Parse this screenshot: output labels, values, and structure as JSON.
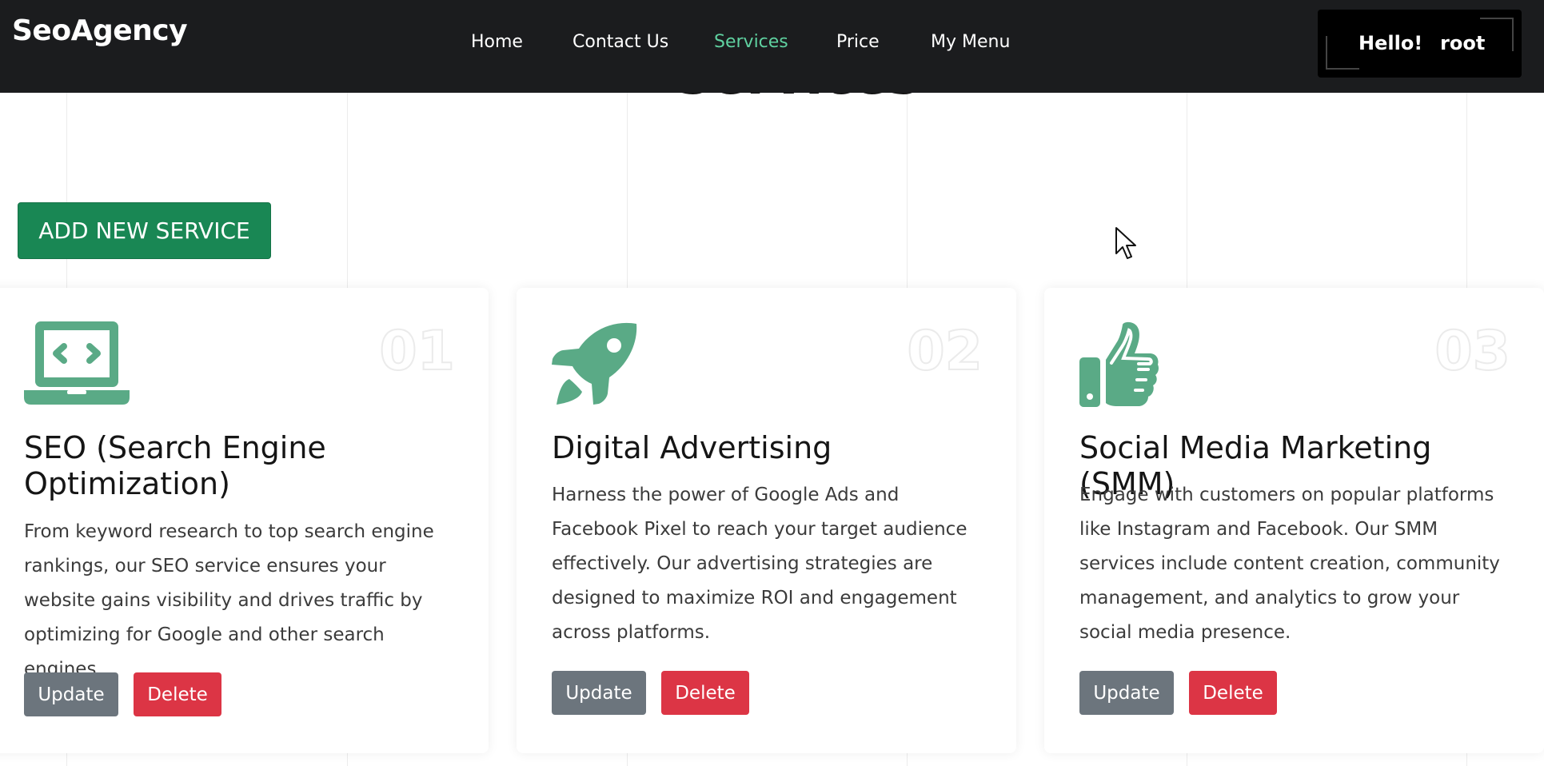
{
  "brand": "SeoAgency",
  "nav": {
    "links": [
      "Home",
      "Contact Us",
      "Services",
      "Price",
      "My Menu"
    ],
    "active": "Services"
  },
  "user": {
    "greeting": "Hello!",
    "name": "root"
  },
  "page_title": "Services",
  "add_button": "ADD NEW SERVICE",
  "colors": {
    "navbar": "#1b1c1e",
    "active_link": "#5fd1a0",
    "icon": "#5aaa86",
    "add_button": "#198754",
    "update_button": "#6c757d",
    "delete_button": "#dc3545"
  },
  "cards": [
    {
      "number": "01",
      "icon": "laptop-code-icon",
      "title": "SEO (Search Engine Optimization)",
      "description": "From keyword research to top search engine rankings, our SEO service ensures your website gains visibility and drives traffic by optimizing for Google and other search engines.",
      "update_label": "Update",
      "delete_label": "Delete"
    },
    {
      "number": "02",
      "icon": "rocket-icon",
      "title": "Digital Advertising",
      "description": "Harness the power of Google Ads and Facebook Pixel to reach your target audience effectively. Our advertising strategies are designed to maximize ROI and engagement across platforms.",
      "update_label": "Update",
      "delete_label": "Delete"
    },
    {
      "number": "03",
      "icon": "thumbs-up-icon",
      "title": "Social Media Marketing (SMM)",
      "description": "Engage with customers on popular platforms like Instagram and Facebook. Our SMM services include content creation, community management, and analytics to grow your social media presence.",
      "update_label": "Update",
      "delete_label": "Delete"
    }
  ]
}
